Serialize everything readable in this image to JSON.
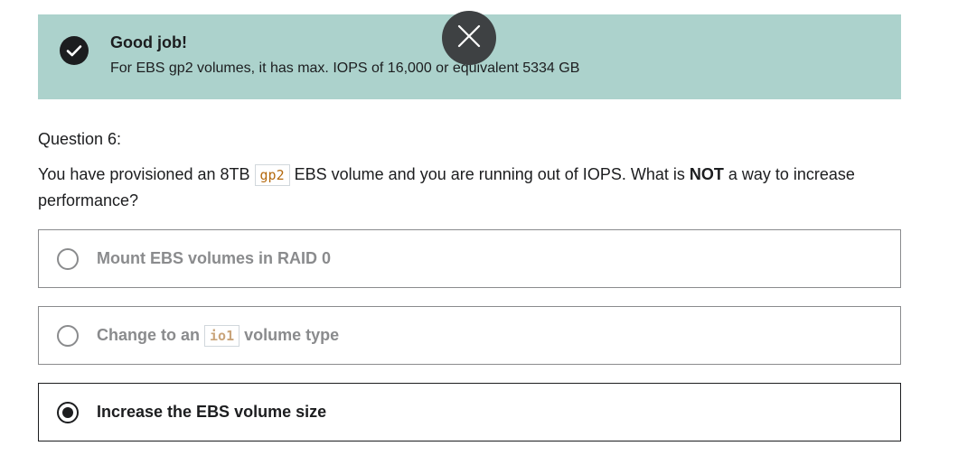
{
  "feedback": {
    "icon": "check-circle-icon",
    "title": "Good job!",
    "text": "For EBS gp2 volumes, it has max. IOPS of 16,000 or equivalent 5334 GB",
    "background": "#acd2cc"
  },
  "close_button": {
    "icon": "close-icon",
    "background": "#3e4143"
  },
  "question": {
    "number": "Question 6:",
    "text_before_code": "You have provisioned an 8TB ",
    "code": "gp2",
    "text_after_code": " EBS volume and you are running out of IOPS. What is ",
    "emphasis": "NOT",
    "text_end": " a way to increase performance?"
  },
  "answers": [
    {
      "label": "Mount EBS volumes in RAID 0",
      "selected": false
    },
    {
      "label_before_code": "Change to an ",
      "code": "io1",
      "label_after_code": " volume type",
      "selected": false
    },
    {
      "label": "Increase the EBS volume size",
      "selected": true
    }
  ],
  "colors": {
    "text": "#1c1d1f",
    "muted": "#8a8b8d",
    "code": "#b4690e"
  }
}
